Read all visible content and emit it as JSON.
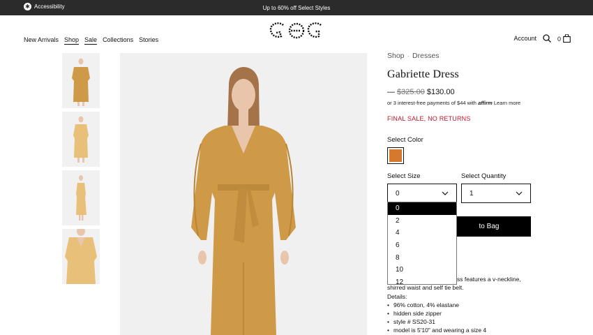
{
  "topbar": {
    "accessibility": "Accessibility",
    "promo": "Up to 60% off Select Styles"
  },
  "nav": [
    {
      "label": "New Arrivals",
      "underline": false
    },
    {
      "label": "Shop",
      "underline": true
    },
    {
      "label": "Sale",
      "underline": true
    },
    {
      "label": "Collections",
      "underline": false
    },
    {
      "label": "Stories",
      "underline": false
    }
  ],
  "header": {
    "account": "Account",
    "cart_count": "0"
  },
  "breadcrumb": {
    "shop": "Shop",
    "separator": "·",
    "category": "Dresses"
  },
  "product": {
    "title": "Gabriette Dress",
    "price_dash": "—",
    "price_was": "$325.00",
    "price_now": "$130.00",
    "affirm_text": "or 3 interest-free payments of $44 with",
    "affirm_brand": "affirm",
    "affirm_link": "Learn more",
    "sale_notice": "FINAL SALE, NO RETURNS",
    "color_label": "Select Color",
    "color_hex": "#d4792e",
    "size_label": "Select Size",
    "size_value": "0",
    "qty_label": "Select Quantity",
    "qty_value": "1",
    "add_to_bag_visible": "to Bag"
  },
  "size_options": [
    "0",
    "2",
    "4",
    "6",
    "8",
    "10",
    "12"
  ],
  "description": {
    "partial_line1": "ss features a v-neckline,",
    "line2": "shirred waist and self tie belt.",
    "details_label": "Details:",
    "details": [
      "96% cotton, 4% elastane",
      "hidden side zipper",
      "style # SS20-31",
      "model is 5'10\" and wearing a size 4"
    ]
  },
  "colors": {
    "dress": "#cf9a48",
    "dress_light": "#e8c07a",
    "skin": "#e9c6ab",
    "hair": "#a4734a",
    "sale_red": "#c0152a"
  }
}
